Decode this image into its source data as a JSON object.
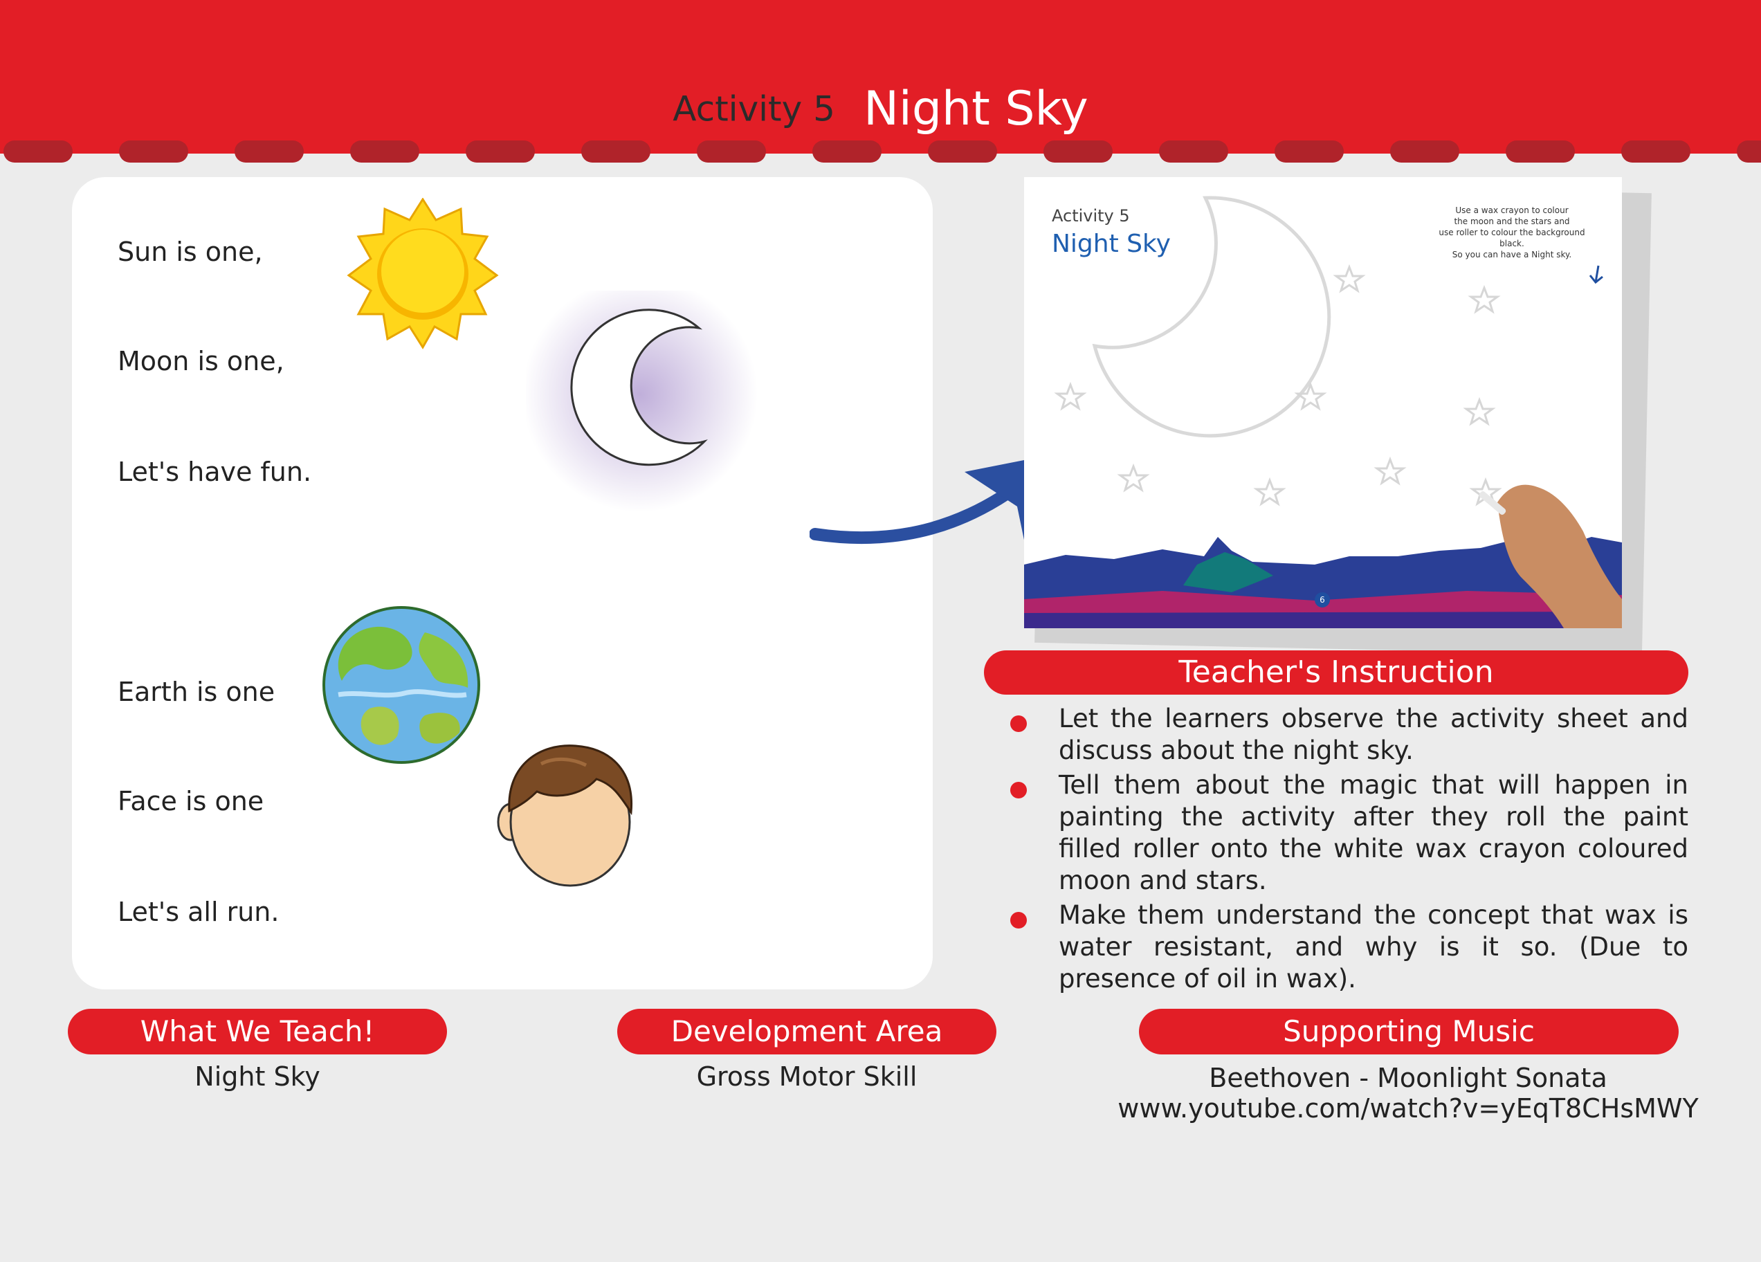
{
  "header": {
    "activity_label": "Activity 5",
    "title": "Night Sky"
  },
  "rhyme": {
    "lines": [
      "Sun is one,",
      "Moon is one,",
      "Let's have fun.",
      "Earth is one",
      "Face is one",
      "Let's all run."
    ]
  },
  "worksheet": {
    "activity_label": "Activity 5",
    "title": "Night Sky",
    "instruction_lines": [
      "Use a wax crayon to colour",
      "the moon and the stars and",
      "use roller to colour the background black.",
      "So you can have a Night sky."
    ],
    "page_number": "6"
  },
  "teachers_instruction": {
    "heading": "Teacher's Instruction",
    "items": [
      "Let the learners observe the activity sheet and discuss about the night sky.",
      "Tell them about the magic that will happen in painting the activity after they roll the paint filled roller onto the white wax crayon coloured moon and stars.",
      "Make them understand the concept that wax is water resistant, and why is it so. (Due to presence of oil in wax)."
    ]
  },
  "what_we_teach": {
    "heading": "What We Teach!",
    "value": "Night Sky"
  },
  "development_area": {
    "heading": "Development Area",
    "value": "Gross Motor Skill"
  },
  "supporting_music": {
    "heading": "Supporting Music",
    "title": "Beethoven - Moonlight Sonata",
    "link": "www.youtube.com/watch?v=yEqT8CHsMWY"
  },
  "colors": {
    "accent_red": "#e21e26",
    "dark_red": "#b0232a",
    "arrow_blue": "#2b4fa0"
  }
}
